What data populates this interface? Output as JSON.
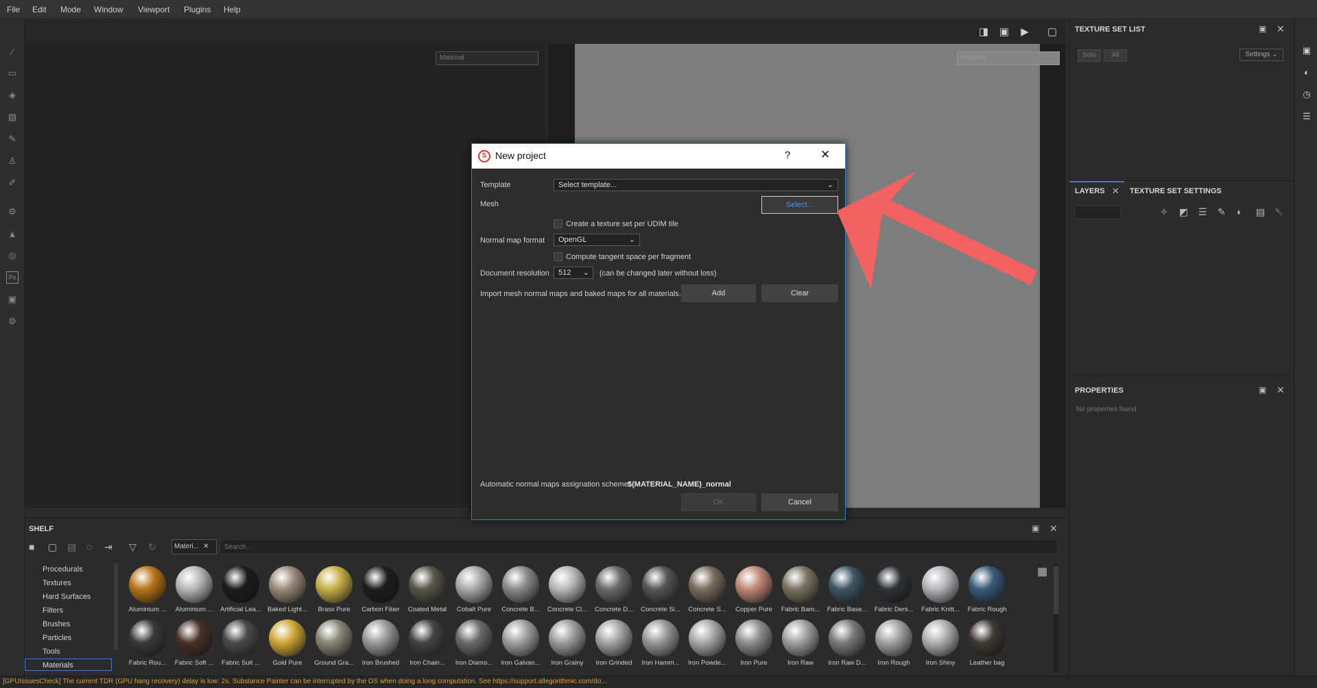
{
  "menubar": {
    "items": [
      "File",
      "Edit",
      "Mode",
      "Window",
      "Viewport",
      "Plugins",
      "Help"
    ]
  },
  "viewport": {
    "material_2d": "Material",
    "material_3d": "Material"
  },
  "texture_set_list": {
    "title": "TEXTURE SET LIST",
    "solo": "Solo",
    "all": "All",
    "settings": "Settings"
  },
  "layers": {
    "tab_layers": "LAYERS",
    "tab_tss": "TEXTURE SET SETTINGS"
  },
  "properties": {
    "title": "PROPERTIES",
    "empty": "No properties found"
  },
  "shelf": {
    "title": "SHELF",
    "filter_tag": "Materi...",
    "search_placeholder": "Search...",
    "categories": [
      "Procedurals",
      "Textures",
      "Hard Surfaces",
      "Filters",
      "Brushes",
      "Particles",
      "Tools",
      "Materials"
    ],
    "materials_row1": [
      {
        "label": "Aluminium ...",
        "color": "#b8741a"
      },
      {
        "label": "Aluminium ...",
        "color": "#b8b8b8"
      },
      {
        "label": "Artificial Lea...",
        "color": "#1c1c1c"
      },
      {
        "label": "Baked Light...",
        "color": "#9a8a7a"
      },
      {
        "label": "Brass Pure",
        "color": "#c8b046"
      },
      {
        "label": "Carbon Fiber",
        "color": "#1e1e1e"
      },
      {
        "label": "Coated Metal",
        "color": "#5a5648"
      },
      {
        "label": "Cobalt Pure",
        "color": "#aaaaaa"
      },
      {
        "label": "Concrete B...",
        "color": "#8a8a8a"
      },
      {
        "label": "Concrete Cl...",
        "color": "#b8b8b8"
      },
      {
        "label": "Concrete D...",
        "color": "#6a6a6a"
      },
      {
        "label": "Concrete Si...",
        "color": "#555555"
      },
      {
        "label": "Concrete S...",
        "color": "#7a6c5e"
      },
      {
        "label": "Copper Pure",
        "color": "#c08878"
      },
      {
        "label": "Fabric Bam...",
        "color": "#7a7460"
      },
      {
        "label": "Fabric Base...",
        "color": "#3e5664"
      },
      {
        "label": "Fabric Deni...",
        "color": "#2e3238"
      },
      {
        "label": "Fabric Knitt...",
        "color": "#b8b4bc"
      },
      {
        "label": "Fabric Rough",
        "color": "#3a5a78"
      }
    ],
    "materials_row2": [
      {
        "label": "Fabric Rou...",
        "color": "#3a3a3a"
      },
      {
        "label": "Fabric Soft ...",
        "color": "#4a3028"
      },
      {
        "label": "Fabric Suit ...",
        "color": "#4a4a4a"
      },
      {
        "label": "Gold Pure",
        "color": "#d0a838"
      },
      {
        "label": "Ground Gra...",
        "color": "#8a8676"
      },
      {
        "label": "Iron Brushed",
        "color": "#9a9a9a"
      },
      {
        "label": "Iron Chain...",
        "color": "#444444"
      },
      {
        "label": "Iron Diamo...",
        "color": "#6a6a6a"
      },
      {
        "label": "Iron Galvan...",
        "color": "#a0a0a0"
      },
      {
        "label": "Iron Grainy",
        "color": "#9c9c9c"
      },
      {
        "label": "Iron Grinded",
        "color": "#a4a4a4"
      },
      {
        "label": "Iron Hamm...",
        "color": "#989898"
      },
      {
        "label": "Iron Powde...",
        "color": "#a8a8a8"
      },
      {
        "label": "Iron Pure",
        "color": "#8e8e8e"
      },
      {
        "label": "Iron Raw",
        "color": "#a0a0a0"
      },
      {
        "label": "Iron Raw D...",
        "color": "#7a7a7a"
      },
      {
        "label": "Iron Rough",
        "color": "#a2a2a2"
      },
      {
        "label": "Iron Shiny",
        "color": "#b0b0b0"
      },
      {
        "label": "Leather bag",
        "color": "#3e3830"
      }
    ]
  },
  "status": {
    "message": "[GPUIssuesCheck] The current TDR (GPU hang recovery) delay is low: 2s. Substance Painter can be interrupted by the OS when doing a long computation. See https://support.allegorithmic.com/do..."
  },
  "dialog": {
    "title": "New project",
    "help": "?",
    "template_label": "Template",
    "template_value": "Select template...",
    "mesh_label": "Mesh",
    "mesh_button": "Select...",
    "udim_label": "Create a texture set per UDIM tile",
    "normal_label": "Normal map format",
    "normal_value": "OpenGL",
    "tangent_label": "Compute tangent space per fragment",
    "resolution_label": "Document resolution",
    "resolution_value": "512",
    "resolution_note": "(can be changed later without loss)",
    "import_label": "Import mesh normal maps and baked maps for all materials.",
    "add_button": "Add",
    "clear_button": "Clear",
    "scheme_label": "Automatic normal maps assignation scheme:",
    "scheme_value": "$(MATERIAL_NAME)_normal",
    "ok_button": "OK",
    "cancel_button": "Cancel"
  },
  "colors": {
    "accent": "#3a7bd5",
    "annotation_arrow": "#f26262",
    "status_warning": "#e0a030"
  }
}
